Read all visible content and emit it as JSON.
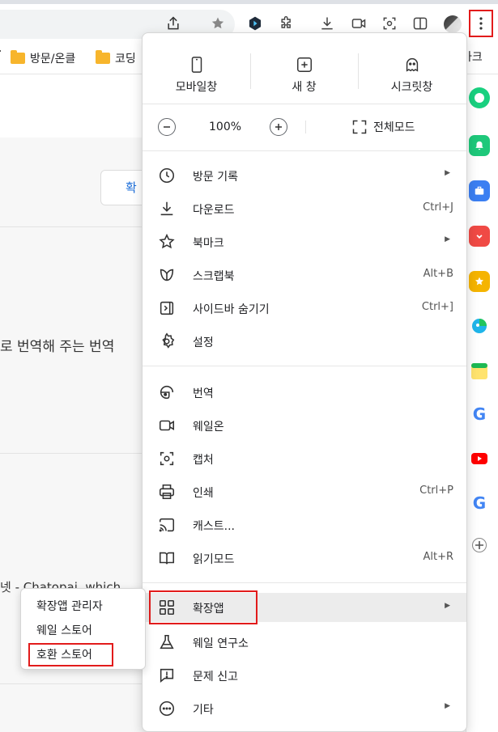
{
  "bookmarks": {
    "folder1": "방문/온클",
    "folder2": "코딩",
    "right_label": "마크"
  },
  "page": {
    "button_label": "확",
    "text_line": "로 번역해 주는 번역",
    "link_text": "넷 - Chatopai, which"
  },
  "menu": {
    "top": {
      "mobile": "모바일창",
      "new_window": "새 창",
      "secret": "시크릿창"
    },
    "zoom": {
      "value": "100%",
      "minus": "−",
      "plus": "+",
      "fullscreen": "전체모드"
    },
    "items": {
      "history": "방문 기록",
      "downloads": "다운로드",
      "downloads_sc": "Ctrl+J",
      "bookmarks": "북마크",
      "scrapbook": "스크랩북",
      "scrapbook_sc": "Alt+B",
      "hide_sidebar": "사이드바 숨기기",
      "hide_sidebar_sc": "Ctrl+]",
      "settings": "설정",
      "translate": "번역",
      "whaleon": "웨일온",
      "capture": "캡처",
      "print": "인쇄",
      "print_sc": "Ctrl+P",
      "cast": "캐스트...",
      "reading": "읽기모드",
      "reading_sc": "Alt+R",
      "extensions": "확장앱",
      "lab": "웨일 연구소",
      "report": "문제 신고",
      "more": "기타"
    }
  },
  "submenu": {
    "manager": "확장앱 관리자",
    "whale_store": "웨일 스토어",
    "compat_store": "호환 스토어"
  },
  "colors": {
    "highlight": "#e21b1b",
    "folder": "#f7b52c"
  }
}
